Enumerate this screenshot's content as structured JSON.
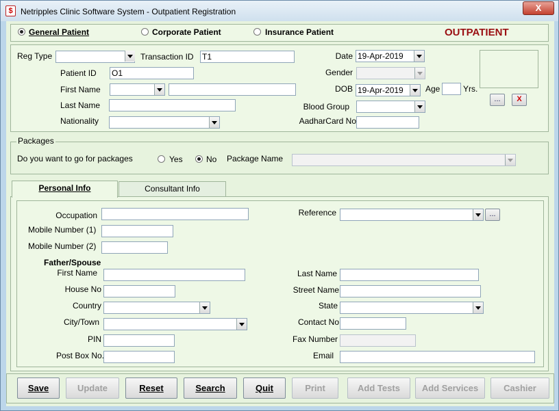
{
  "window": {
    "title": "Netripples Clinic Software System - Outpatient Registration",
    "close_label": "X"
  },
  "patient_type": {
    "general": "General Patient",
    "corporate": "Corporate Patient",
    "insurance": "Insurance Patient",
    "selected": "general",
    "banner": "OUTPATIENT"
  },
  "registration": {
    "reg_type_label": "Reg Type",
    "reg_type_value": "",
    "transaction_id_label": "Transaction ID",
    "transaction_id_value": "T1",
    "date_label": "Date",
    "date_value": "19-Apr-2019",
    "patient_id_label": "Patient ID",
    "patient_id_value": "O1",
    "gender_label": "Gender",
    "gender_value": "",
    "first_name_label": "First Name",
    "title_value": "",
    "first_name_value": "",
    "dob_label": "DOB",
    "dob_value": "19-Apr-2019",
    "age_label": "Age",
    "age_value": "",
    "yrs_label": "Yrs.",
    "last_name_label": "Last Name",
    "last_name_value": "",
    "blood_group_label": "Blood Group",
    "blood_group_value": "",
    "nationality_label": "Nationality",
    "nationality_value": "",
    "aadhar_label": "AadharCard No",
    "aadhar_value": "",
    "browse_label": "...",
    "remove_label": "X"
  },
  "packages": {
    "legend": "Packages",
    "question": "Do you want to go for packages",
    "yes": "Yes",
    "no": "No",
    "selected": "no",
    "package_name_label": "Package Name",
    "package_name_value": ""
  },
  "tabs": [
    {
      "label": "Personal Info",
      "active": true
    },
    {
      "label": "Consultant Info",
      "active": false
    }
  ],
  "personal": {
    "occupation_label": "Occupation",
    "occupation_value": "",
    "reference_label": "Reference",
    "reference_value": "",
    "reference_btn": "...",
    "mobile1_label": "Mobile Number (1)",
    "mobile1_value": "",
    "mobile2_label": "Mobile Number (2)",
    "mobile2_value": "",
    "section_title": "Father/Spouse",
    "fs_first_name_label": "First Name",
    "fs_first_name_value": "",
    "fs_last_name_label": "Last Name",
    "fs_last_name_value": "",
    "house_no_label": "House No",
    "house_no_value": "",
    "street_name_label": "Street Name",
    "street_name_value": "",
    "country_label": "Country",
    "country_value": "",
    "state_label": "State",
    "state_value": "",
    "city_label": "City/Town",
    "city_value": "",
    "contact_label": "Contact No",
    "contact_value": "",
    "pin_label": "PIN",
    "pin_value": "",
    "fax_label": "Fax Number",
    "fax_value": "",
    "postbox_label": "Post Box No.",
    "postbox_value": "",
    "email_label": "Email",
    "email_value": ""
  },
  "buttons": {
    "save": "Save",
    "update": "Update",
    "reset": "Reset",
    "search": "Search",
    "quit": "Quit",
    "print": "Print",
    "add_tests": "Add Tests",
    "add_services": "Add Services",
    "cashier": "Cashier"
  }
}
